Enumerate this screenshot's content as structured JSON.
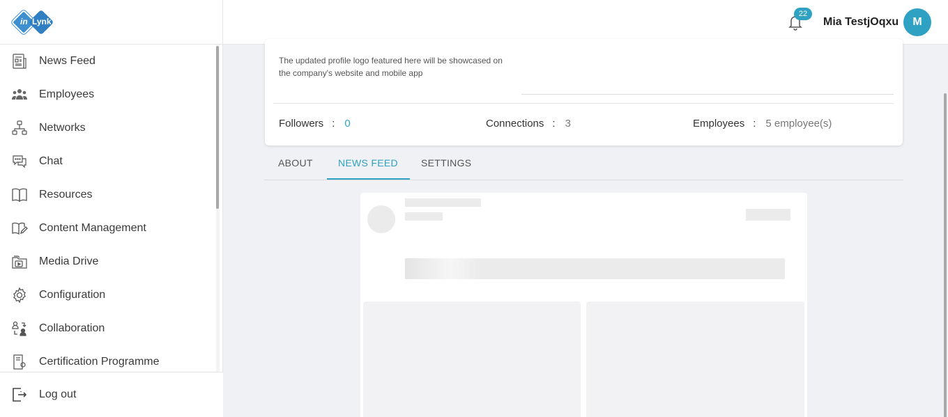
{
  "brand": {
    "logo_text_in": "in",
    "logo_text_lynk": "Lynk"
  },
  "sidebar": {
    "items": [
      {
        "label": "News Feed",
        "icon": "news-feed-icon"
      },
      {
        "label": "Employees",
        "icon": "employees-icon"
      },
      {
        "label": "Networks",
        "icon": "networks-icon"
      },
      {
        "label": "Chat",
        "icon": "chat-icon"
      },
      {
        "label": "Resources",
        "icon": "book-icon"
      },
      {
        "label": "Content Management",
        "icon": "content-management-icon"
      },
      {
        "label": "Media Drive",
        "icon": "media-drive-icon"
      },
      {
        "label": "Configuration",
        "icon": "gear-icon"
      },
      {
        "label": "Collaboration",
        "icon": "collaboration-icon"
      },
      {
        "label": "Certification Programme",
        "icon": "certificate-icon"
      }
    ],
    "logout_label": "Log out"
  },
  "header": {
    "notification_count": "22",
    "user_name": "Mia TestjOqxu",
    "avatar_initial": "M",
    "accent_color": "#2fa2c4"
  },
  "profile": {
    "logo_note": "The updated profile logo featured here will be showcased on the company's website and mobile app",
    "stats": {
      "followers_label": "Followers",
      "followers_value": "0",
      "connections_label": "Connections",
      "connections_value": "3",
      "employees_label": "Employees",
      "employees_value": "5 employee(s)",
      "separator": ":"
    }
  },
  "tabs": [
    {
      "label": "ABOUT",
      "active": false
    },
    {
      "label": "NEWS FEED",
      "active": true
    },
    {
      "label": "SETTINGS",
      "active": false
    }
  ]
}
